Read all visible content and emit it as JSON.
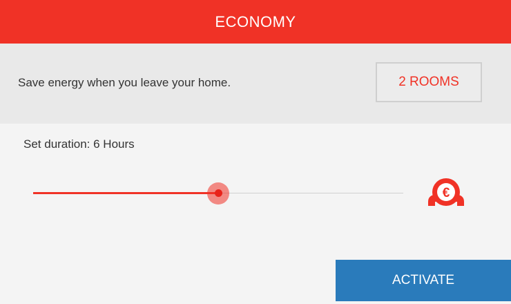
{
  "header": {
    "title": "ECONOMY"
  },
  "info": {
    "description": "Save energy when you leave your home.",
    "rooms_button_label": "2 ROOMS"
  },
  "duration": {
    "label": "Set duration: 6 Hours",
    "slider_fraction": 0.5
  },
  "icons": {
    "savings": "euro-coin-icon"
  },
  "actions": {
    "activate_label": "ACTIVATE"
  },
  "colors": {
    "accent": "#f03226",
    "primary_button": "#2a7bbb",
    "info_background": "#e9e9e9",
    "page_background": "#f4f4f4"
  }
}
